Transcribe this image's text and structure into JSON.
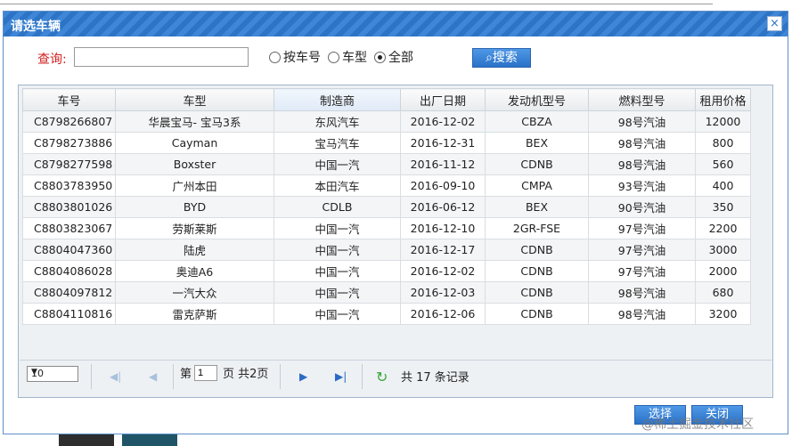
{
  "dialog": {
    "title": "请选车辆",
    "close_glyph": "×"
  },
  "query": {
    "label": "查询:",
    "input_value": "",
    "radios": [
      {
        "label": "按车号",
        "checked": false
      },
      {
        "label": "车型",
        "checked": false
      },
      {
        "label": "全部",
        "checked": true
      }
    ],
    "search_label": "搜索"
  },
  "grid": {
    "columns": [
      "车号",
      "车型",
      "制造商",
      "出厂日期",
      "发动机型号",
      "燃料型号",
      "租用价格"
    ],
    "selected_column": 2,
    "rows": [
      [
        "C8798266807",
        "华晨宝马- 宝马3系",
        "东风汽车",
        "2016-12-02",
        "CBZA",
        "98号汽油",
        "12000"
      ],
      [
        "C8798273886",
        "Cayman",
        "宝马汽车",
        "2016-12-31",
        "BEX",
        "98号汽油",
        "800"
      ],
      [
        "C8798277598",
        "Boxster",
        "中国一汽",
        "2016-11-12",
        "CDNB",
        "98号汽油",
        "560"
      ],
      [
        "C8803783950",
        "广州本田",
        "本田汽车",
        "2016-09-10",
        "CMPA",
        "93号汽油",
        "400"
      ],
      [
        "C8803801026",
        "BYD",
        "CDLB",
        "2016-06-12",
        "BEX",
        "90号汽油",
        "350"
      ],
      [
        "C8803823067",
        "劳斯莱斯",
        "中国一汽",
        "2016-12-10",
        "2GR-FSE",
        "97号汽油",
        "2200"
      ],
      [
        "C8804047360",
        "陆虎",
        "中国一汽",
        "2016-12-17",
        "CDNB",
        "97号汽油",
        "3000"
      ],
      [
        "C8804086028",
        "奥迪A6",
        "中国一汽",
        "2016-12-02",
        "CDNB",
        "97号汽油",
        "2000"
      ],
      [
        "C8804097812",
        "一汽大众",
        "中国一汽",
        "2016-12-03",
        "CDNB",
        "98号汽油",
        "680"
      ],
      [
        "C8804110816",
        "雷克萨斯",
        "中国一汽",
        "2016-12-06",
        "CDNB",
        "98号汽油",
        "3200"
      ]
    ]
  },
  "pager": {
    "page_size": "10",
    "page_prefix": "第",
    "current_page": "1",
    "page_suffix": "页 共2页",
    "records_text": "共 17 条记录",
    "icons": [
      "first-page-icon",
      "prev-page-icon",
      "next-page-icon",
      "last-page-icon",
      "refresh-icon"
    ]
  },
  "footer": {
    "confirm_label": "选择",
    "cancel_label": "关闭"
  },
  "watermark": "@稀土掘金技术社区",
  "colors": {
    "title_bar": "#2e74c6",
    "button": "#2a72c8",
    "query_label": "#d22020"
  }
}
